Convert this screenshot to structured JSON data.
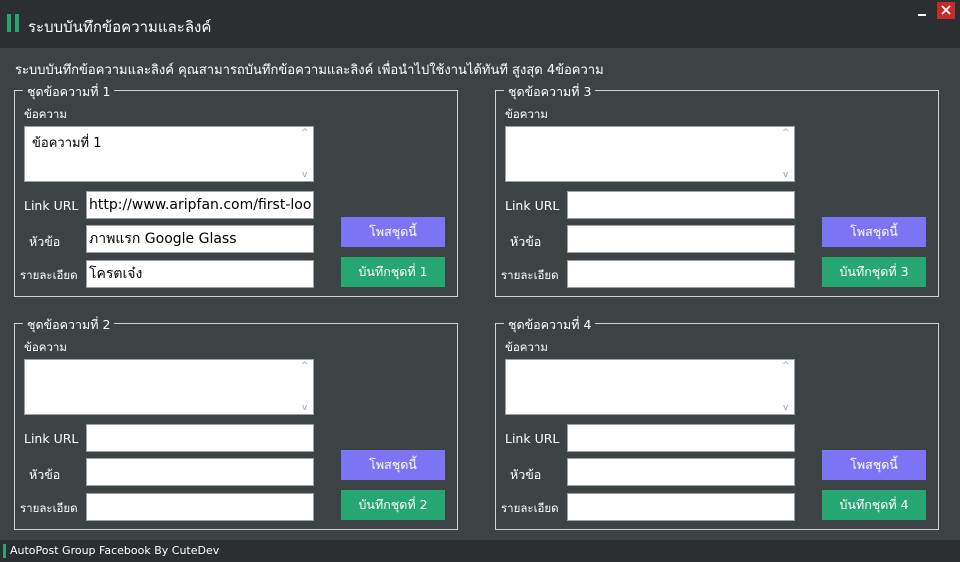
{
  "window": {
    "title": "ระบบบันทึกข้อความและลิงค์",
    "close_glyph": "✕"
  },
  "description": "ระบบบันทึกข้อความและลิงค์ คุณสามารถบันทึกข้อความและลิงค์ เพื่อนำไปใช้งานได้ทันที สูงสุด 4ข้อความ",
  "labels": {
    "message": "ข้อความ",
    "link_url": "Link URL",
    "heading": "หัวข้อ",
    "details": "รายละเอียด"
  },
  "groups": [
    {
      "legend": "ชุดข้อความที่ 1",
      "message": "ข้อความที่ 1",
      "link_url": "http://www.aripfan.com/first-loo",
      "heading": "ภาพแรก Google Glass",
      "details": "โครตเจ๋ง",
      "post_label": "โพสชุดนี้",
      "save_label": "บันทึกชุดที่ 1"
    },
    {
      "legend": "ชุดข้อความที่ 3",
      "message": "",
      "link_url": "",
      "heading": "",
      "details": "",
      "post_label": "โพสชุดนี้",
      "save_label": "บันทึกชุดที่ 3"
    },
    {
      "legend": "ชุดข้อความที่ 2",
      "message": "",
      "link_url": "",
      "heading": "",
      "details": "",
      "post_label": "โพสชุดนี้",
      "save_label": "บันทึกชุดที่ 2"
    },
    {
      "legend": "ชุดข้อความที่ 4",
      "message": "",
      "link_url": "",
      "heading": "",
      "details": "",
      "post_label": "โพสชุดนี้",
      "save_label": "บันทึกชุดที่ 4"
    }
  ],
  "status": "AutoPost Group Facebook By CuteDev",
  "colors": {
    "background": "#2b2f32",
    "panel": "#3d4245",
    "accent_green": "#26a672",
    "post_button": "#7b75f5",
    "close_button": "#c42b2b"
  }
}
